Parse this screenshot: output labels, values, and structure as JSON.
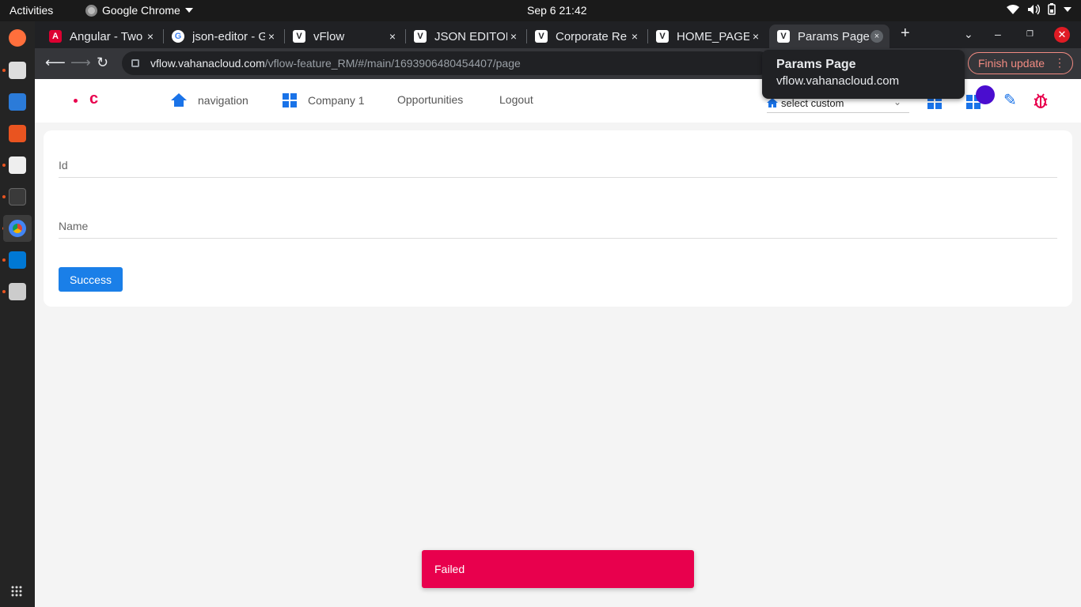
{
  "system": {
    "activities_label": "Activities",
    "app_name": "Google Chrome",
    "clock": "Sep 6  21:42"
  },
  "tabs": [
    {
      "title": "Angular - Two",
      "favicon": "angular-icon",
      "close": "×"
    },
    {
      "title": "json-editor - G",
      "favicon": "google-icon",
      "close": "×"
    },
    {
      "title": "vFlow",
      "favicon": "vflow-icon",
      "close": "×"
    },
    {
      "title": "JSON EDITOR",
      "favicon": "vflow-icon",
      "close": "×"
    },
    {
      "title": "Corporate Re",
      "favicon": "vflow-icon",
      "close": "×"
    },
    {
      "title": "HOME_PAGE",
      "favicon": "vflow-icon",
      "close": "×"
    },
    {
      "title": "Params Page",
      "favicon": "vflow-icon",
      "close": "×",
      "active": true
    }
  ],
  "new_tab_label": "+",
  "address": {
    "domain": "vflow.vahanacloud.com",
    "path": "/vflow-feature_RM/#/main/1693906480454407/page"
  },
  "finish_update_label": "Finish update",
  "tooltip": {
    "title": "Params Page",
    "url": "vflow.vahanacloud.com"
  },
  "app_nav": {
    "logo_text": "c",
    "items": [
      "navigation",
      "Company 1",
      "Opportunities",
      "Logout"
    ],
    "select_value": "select custom"
  },
  "form": {
    "id_label": "Id",
    "name_label": "Name",
    "success_label": "Success"
  },
  "snackbar": {
    "message": "Failed"
  },
  "colors": {
    "accent": "#1a7fe8",
    "brand": "#e8004d",
    "avatar": "#4a0dcf"
  }
}
